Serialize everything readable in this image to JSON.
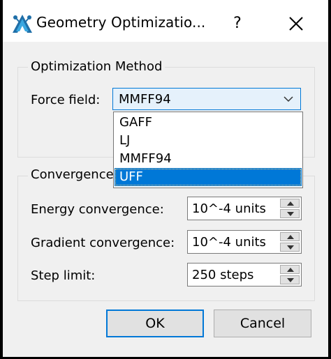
{
  "window": {
    "title": "Geometry Optimizatio...",
    "help_label": "?",
    "close_icon": "close-icon",
    "app_icon": "avogadro-logo-icon"
  },
  "optimization_method": {
    "group_title": "Optimization Method",
    "force_field_label": "Force field:",
    "force_field_value": "MMFF94",
    "dropdown_open": true,
    "options": [
      "GAFF",
      "LJ",
      "MMFF94",
      "UFF"
    ],
    "highlighted_option": "UFF"
  },
  "convergence": {
    "group_title": "Convergence",
    "fields": [
      {
        "label": "Energy convergence:",
        "value": "10^-4 units"
      },
      {
        "label": "Gradient convergence:",
        "value": "10^-4 units"
      },
      {
        "label": "Step limit:",
        "value": "250 steps"
      }
    ]
  },
  "buttons": {
    "ok_label": "OK",
    "cancel_label": "Cancel"
  },
  "colors": {
    "accent": "#0078d7",
    "window_bg": "#f0f0f0",
    "titlebar_bg": "#ffffff",
    "combo_bg": "#e5f1fb"
  }
}
